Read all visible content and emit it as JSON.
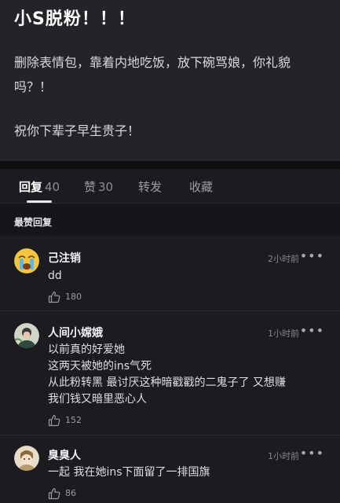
{
  "post": {
    "title": "小S脱粉！！！",
    "body_line1": "删除表情包，靠着内地吃饭，放下碗骂娘，你礼貌",
    "body_line2": "吗？！",
    "body_line3": "祝你下辈子早生贵子！"
  },
  "tabs": [
    {
      "label": "回复",
      "count": "40",
      "active": true
    },
    {
      "label": "赞",
      "count": "30",
      "active": false
    },
    {
      "label": "转发",
      "count": "",
      "active": false
    },
    {
      "label": "收藏",
      "count": "",
      "active": false
    }
  ],
  "section_label": "最赞回复",
  "more_label": "•••",
  "comments": [
    {
      "name": "己注销",
      "time": "2小时前",
      "lines": [
        "dd"
      ],
      "likes": "180"
    },
    {
      "name": "人间小嫦娥",
      "time": "1小时前",
      "lines": [
        "以前真的好爱她",
        "这两天被她的ins气死",
        "从此粉转黑 最讨厌这种暗戳戳的二鬼子了 又想赚",
        "我们钱又暗里恶心人"
      ],
      "likes": "152"
    },
    {
      "name": "臭臭人",
      "time": "1小时前",
      "lines": [
        "一起 我在她ins下面留了一排国旗"
      ],
      "likes": "86"
    }
  ]
}
